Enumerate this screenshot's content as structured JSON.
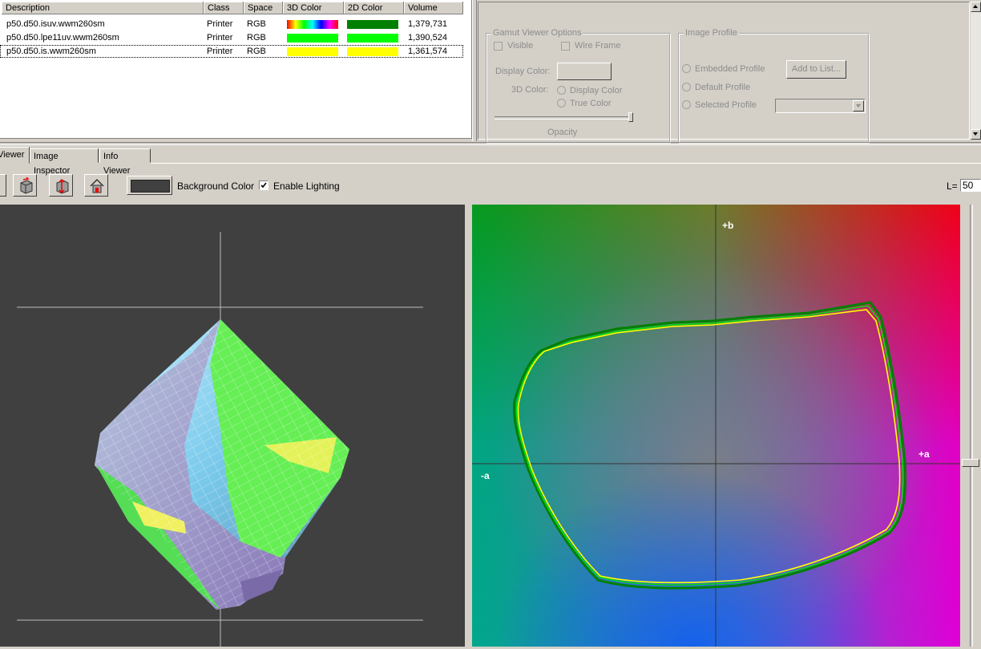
{
  "table": {
    "headers": [
      "Description",
      "Class",
      "Space",
      "3D Color",
      "2D Color",
      "Volume"
    ],
    "rows": [
      {
        "description": "p50.d50.isuv.wwm260sm",
        "class": "Printer",
        "space": "RGB",
        "color3d": "rainbow",
        "color2d": "#008000",
        "volume": "1,379,731"
      },
      {
        "description": "p50.d50.lpe11uv.wwm260sm",
        "class": "Printer",
        "space": "RGB",
        "color3d": "#00ff00",
        "color2d": "#00ff00",
        "volume": "1,390,524"
      },
      {
        "description": "p50.d50.is.wwm260sm",
        "class": "Printer",
        "space": "RGB",
        "color3d": "#ffff00",
        "color2d": "#ffff00",
        "volume": "1,361,574"
      }
    ]
  },
  "gamut_options": {
    "title": "Gamut Viewer Options",
    "visible_label": "Visible",
    "wireframe_label": "Wire Frame",
    "display_color_label": "Display Color:",
    "color3d_label": "3D Color:",
    "radio_display_color": "Display Color",
    "radio_true_color": "True Color",
    "opacity_label": "Opacity"
  },
  "image_profile": {
    "title": "Image Profile",
    "embedded": "Embedded Profile",
    "default": "Default Profile",
    "selected": "Selected Profile",
    "add_button": "Add to List..."
  },
  "tabs": [
    "Viewer",
    "Image Inspector",
    "Info Viewer"
  ],
  "toolbar": {
    "background_color_label": "Background Color",
    "enable_lighting_label": "Enable Lighting",
    "enable_lighting_checked": true,
    "l_label": "L=",
    "l_value": "50"
  },
  "plot": {
    "plus_b": "+b",
    "minus_a": "-a",
    "plus_a": "+a"
  },
  "colors": {
    "viewer_bg": "#404040",
    "gamut_green": "#008000",
    "gamut_lime": "#00ff00",
    "gamut_yellow": "#ffff00"
  }
}
